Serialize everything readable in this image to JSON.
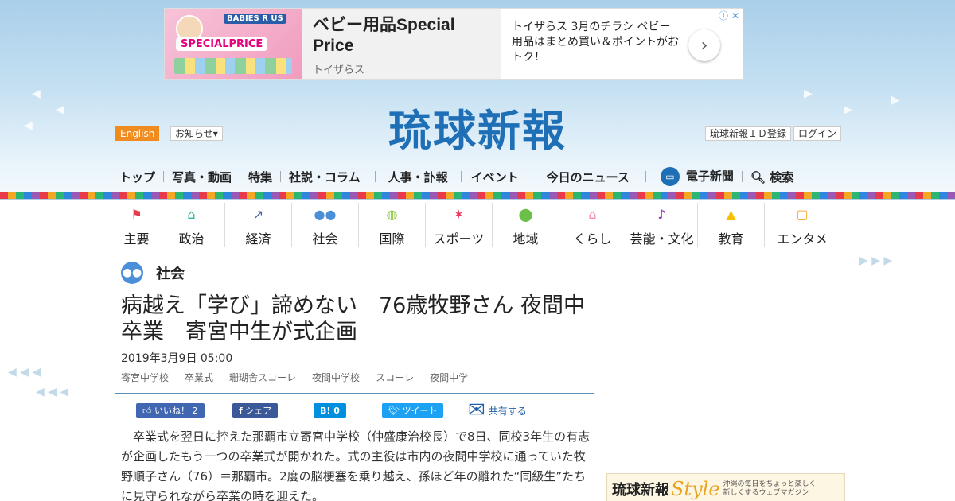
{
  "ad": {
    "info_icon": "ⓘ",
    "close_icon": "✕",
    "brand": "BABIES R US",
    "image_text": "SPECIALPRICE",
    "title": "ベビー用品Special Price",
    "source": "トイザらス",
    "description": "トイザらス 3月のチラシ ベビー用品はまとめ買い＆ポイントがおトク！",
    "arrow_icon": "›"
  },
  "header": {
    "logo": "琉球新報",
    "english": "English",
    "notice": "お知らせ▾",
    "register": "琉球新報ＩＤ登録",
    "login": "ログイン"
  },
  "mainnav": {
    "items": [
      "トップ",
      "写真・動画",
      "特集",
      "社説・コラム",
      "人事・訃報",
      "イベント",
      "今日のニュース"
    ],
    "digital": "電子新聞",
    "search": "検索"
  },
  "categories": [
    {
      "label": "主要",
      "icon": "⚑",
      "color": "#e83a4b"
    },
    {
      "label": "政治",
      "icon": "⌂",
      "color": "#2bb6a0"
    },
    {
      "label": "経済",
      "icon": "↗",
      "color": "#3a5fa8"
    },
    {
      "label": "社会",
      "icon": "●●",
      "color": "#4a8fd8"
    },
    {
      "label": "国際",
      "icon": "◍",
      "color": "#8cc63f"
    },
    {
      "label": "スポーツ",
      "icon": "✶",
      "color": "#e8365d"
    },
    {
      "label": "地域",
      "icon": "⬤",
      "color": "#6cc04a"
    },
    {
      "label": "くらし",
      "icon": "⌂",
      "color": "#f58fb0"
    },
    {
      "label": "芸能・文化",
      "icon": "♪",
      "color": "#9b3bb6"
    },
    {
      "label": "教育",
      "icon": "▲",
      "color": "#f5c000"
    },
    {
      "label": "エンタメ",
      "icon": "▢",
      "color": "#f5a623"
    }
  ],
  "article": {
    "section": "社会",
    "headline": "病越え「学び」諦めない　76歳牧野さん 夜間中卒業　寄宮中生が式企画",
    "date": "2019年3月9日 05:00",
    "tags": [
      "寄宮中学校",
      "卒業式",
      "珊瑚舎スコーレ",
      "夜間中学校",
      "スコーレ",
      "夜間中学"
    ],
    "share": {
      "like": "いいね！ 2",
      "facebook": "シェア",
      "hatena": "B! 0",
      "tweet": "ツイート",
      "mail": "共有する"
    },
    "body": "　卒業式を翌日に控えた那覇市立寄宮中学校（仲盛康治校長）で8日、同校3年生の有志が企画したもう一つの卒業式が開かれた。式の主役は市内の夜間中学校に通っていた牧野順子さん（76）＝那覇市。2度の脳梗塞を乗り越え、孫ほど年の離れた“同級生”たちに見守られながら卒業の時を迎えた。"
  },
  "side_banner": {
    "name": "琉球新報",
    "style": "Style",
    "tagline": "沖縄の毎日をちょっと楽しく新しくするウェブマガジン"
  }
}
